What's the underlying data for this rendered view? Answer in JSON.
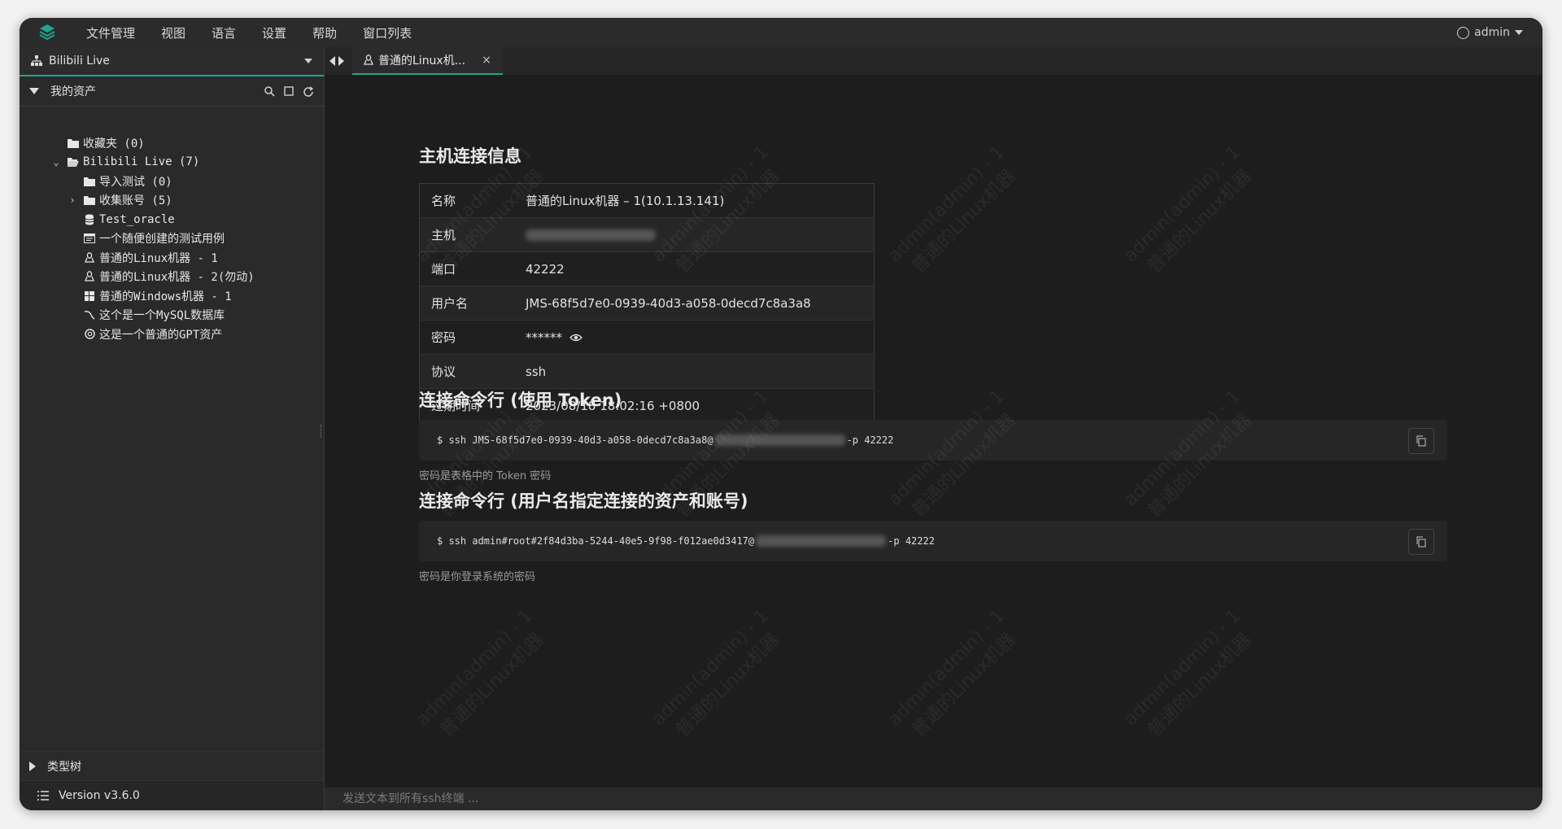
{
  "menubar": {
    "items": [
      "文件管理",
      "视图",
      "语言",
      "设置",
      "帮助",
      "窗口列表"
    ],
    "user": "admin"
  },
  "sidebar": {
    "org": "Bilibili Live",
    "assets_title": "我的资产",
    "tree": [
      {
        "label": "收藏夹 (0)",
        "icon": "folder-icon",
        "indent": 0,
        "expander": ""
      },
      {
        "label": "Bilibili Live (7)",
        "icon": "folder-open-icon",
        "indent": 0,
        "expander": "v"
      },
      {
        "label": "导入测试 (0)",
        "icon": "folder-icon",
        "indent": 1,
        "expander": ""
      },
      {
        "label": "收集账号 (5)",
        "icon": "folder-icon",
        "indent": 1,
        "expander": ">"
      },
      {
        "label": "Test_oracle",
        "icon": "database-icon",
        "indent": 1,
        "expander": ""
      },
      {
        "label": "一个随便创建的测试用例",
        "icon": "window-icon",
        "indent": 1,
        "expander": ""
      },
      {
        "label": "普通的Linux机器 - 1",
        "icon": "linux-icon",
        "indent": 1,
        "expander": ""
      },
      {
        "label": "普通的Linux机器 - 2(勿动)",
        "icon": "linux-icon",
        "indent": 1,
        "expander": ""
      },
      {
        "label": "普通的Windows机器 - 1",
        "icon": "windows-icon",
        "indent": 1,
        "expander": ""
      },
      {
        "label": "这个是一个MySQL数据库",
        "icon": "mysql-icon",
        "indent": 1,
        "expander": ""
      },
      {
        "label": "这是一个普通的GPT资产",
        "icon": "gpt-icon",
        "indent": 1,
        "expander": ""
      }
    ],
    "type_tree": "类型树",
    "version": "Version v3.6.0"
  },
  "tab": {
    "label": "普通的Linux机...",
    "close": "×"
  },
  "main": {
    "info_title": "主机连接信息",
    "info_rows": [
      {
        "key": "名称",
        "value": "普通的Linux机器 – 1(10.1.13.141)"
      },
      {
        "key": "主机",
        "value": ""
      },
      {
        "key": "端口",
        "value": "42222"
      },
      {
        "key": "用户名",
        "value": "JMS-68f5d7e0-0939-40d3-a058-0decd7c8a3a8"
      },
      {
        "key": "密码",
        "value": "******"
      },
      {
        "key": "协议",
        "value": "ssh"
      },
      {
        "key": "过期时间",
        "value": "2023/08/18 18:02:16 +0800"
      }
    ],
    "cmd1_title": "连接命令行 (使用 Token)",
    "cmd1_prefix": "$ ssh JMS-68f5d7e0-0939-40d3-a058-0decd7c8a3a8@",
    "cmd1_suffix": "-p 42222",
    "cmd1_note": "密码是表格中的 Token 密码",
    "cmd2_title": "连接命令行 (用户名指定连接的资产和账号)",
    "cmd2_prefix": "$ ssh admin#root#2f84d3ba-5244-40e5-9f98-f012ae0d3417@",
    "cmd2_suffix": "-p 42222",
    "cmd2_note": "密码是你登录系统的密码",
    "watermark_line1": "admin(admin) - 1",
    "watermark_line2": "普通的Linux机器"
  },
  "statusbar": {
    "placeholder": "发送文本到所有ssh终端 ..."
  },
  "colors": {
    "accent": "#1aa88d",
    "background": "#1d1d1d",
    "sidebar": "#2a2a2a"
  }
}
